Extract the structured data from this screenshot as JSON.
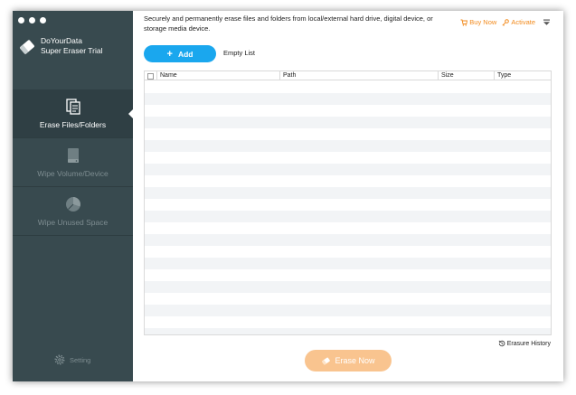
{
  "app": {
    "name_line1": "DoYourData",
    "name_line2": "Super Eraser Trial"
  },
  "sidebar": {
    "items": [
      {
        "label": "Erase Files/Folders",
        "icon": "files-icon",
        "active": true
      },
      {
        "label": "Wipe Volume/Device",
        "icon": "drive-icon",
        "active": false
      },
      {
        "label": "Wipe Unused Space",
        "icon": "pie-chart-icon",
        "active": false
      }
    ],
    "setting_label": "Setting"
  },
  "header": {
    "description": "Securely and permanently erase files and folders from local/external hard drive, digital device, or storage media device.",
    "buy_now": "Buy Now",
    "activate": "Activate"
  },
  "toolbar": {
    "add_label": "Add",
    "empty_list_label": "Empty List"
  },
  "table": {
    "columns": [
      "Name",
      "Path",
      "Size",
      "Type"
    ],
    "rows": []
  },
  "footer": {
    "erasure_history": "Erasure History",
    "erase_now": "Erase Now"
  },
  "colors": {
    "sidebar_bg": "#384a4f",
    "accent_blue": "#1aa7ee",
    "accent_orange": "#f28a1c",
    "erase_button_disabled": "#f9c48f"
  }
}
